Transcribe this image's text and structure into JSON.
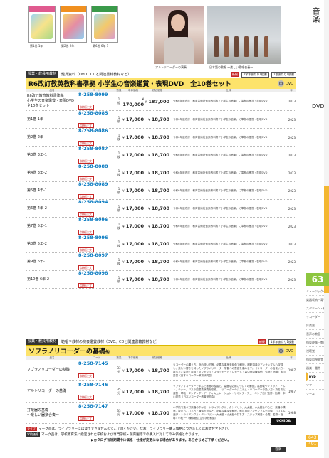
{
  "side": {
    "title": "音楽",
    "dvd": "DVD",
    "page_tab": "63",
    "page_num_1": "643",
    "page_num_2": "491",
    "menu": [
      "ミュージックベル",
      "楽器収納・電子楽器",
      "スクリーン・補助教材",
      "リコーダー",
      "打楽器",
      "音声の教室",
      "指導映像・教材",
      "視聴覚",
      "指導用視聴覚",
      "器楽・鑑賞",
      "DVD",
      "ソフト",
      "ツール"
    ]
  },
  "images": {
    "captions": [
      "第1巻 1年",
      "第2巻 2年",
      "第6巻 6年-1",
      "アルトリコーダーの演奏",
      "日本語の歌唱 ～楽しい歌唱合奏～"
    ]
  },
  "section1": {
    "cat_tag": "授業・教員用教材",
    "cat_text": "鑑賞資料（DVD、CDと関連書籍教材など）",
    "flag": "新規",
    "qty_note": "1学年あたり1枚書",
    "box_note": "1枚あたり1枚書",
    "title": "R6改訂教英教科書準拠 小学生の音楽鑑賞・表現DVD　全10巻セット",
    "dvd_label": "DVD",
    "headers": [
      "品名",
      "コード",
      "数量",
      "本体価格",
      "税込価格",
      "仕様",
      "年"
    ],
    "rows": [
      {
        "name": "R6改訂教育教科書準拠\n小学生の音楽鑑賞・表現DVD\n全10巻セット",
        "code": "8-258-8099",
        "btn": "詳細注文",
        "qty": "1\n組",
        "p1": "170,000",
        "p2": "187,000",
        "desc": "令和6年度改訂　教育芸術社音楽教科書「小学生の音楽」に準拠の鑑賞・表現DVD",
        "year": "2023"
      },
      {
        "name": "第1巻 1年",
        "code": "8-258-8085",
        "btn": "詳細注文",
        "qty": "1\n枚",
        "p1": "17,000",
        "p2": "18,700",
        "desc": "令和6年度改訂　教育芸術社音楽教科書「小学生の音楽」に準拠の鑑賞・表現DVD",
        "year": "2023"
      },
      {
        "name": "第2巻 2年",
        "code": "8-258-8086",
        "btn": "詳細注文",
        "qty": "1\n枚",
        "p1": "17,000",
        "p2": "18,700",
        "desc": "令和6年度改訂　教育芸術社音楽教科書「小学生の音楽」に準拠の鑑賞・表現DVD",
        "year": "2023"
      },
      {
        "name": "第3巻 3年-1",
        "code": "8-258-8087",
        "btn": "詳細注文",
        "qty": "1\n枚",
        "p1": "17,000",
        "p2": "18,700",
        "desc": "令和6年度改訂　教育芸術社音楽教科書「小学生の音楽」に準拠の鑑賞・表現DVD",
        "year": "2023"
      },
      {
        "name": "第4巻 3年-2",
        "code": "8-258-8088",
        "btn": "詳細注文",
        "qty": "1\n枚",
        "p1": "17,000",
        "p2": "18,700",
        "desc": "令和6年度改訂　教育芸術社音楽教科書「小学生の音楽」に準拠の鑑賞・表現DVD",
        "year": "2023"
      },
      {
        "name": "第5巻 4年-1",
        "code": "8-258-8089",
        "btn": "詳細注文",
        "qty": "1\n枚",
        "p1": "17,000",
        "p2": "18,700",
        "desc": "令和6年度改訂　教育芸術社音楽教科書「小学生の音楽」に準拠の鑑賞・表現DVD",
        "year": "2023"
      },
      {
        "name": "第6巻 4年-2",
        "code": "8-258-8094",
        "btn": "詳細注文",
        "qty": "1\n枚",
        "p1": "17,000",
        "p2": "18,700",
        "desc": "令和6年度改訂　教育芸術社音楽教科書「小学生の音楽」に準拠の鑑賞・表現DVD",
        "year": "2023"
      },
      {
        "name": "第7巻 5年-1",
        "code": "8-258-8095",
        "btn": "詳細注文",
        "qty": "1\n枚",
        "p1": "17,000",
        "p2": "18,700",
        "desc": "令和6年度改訂　教育芸術社音楽教科書「小学生の音楽」に準拠の鑑賞・表現DVD",
        "year": "2023"
      },
      {
        "name": "第8巻 5年-2",
        "code": "8-258-8096",
        "btn": "詳細注文",
        "qty": "1\n枚",
        "p1": "17,000",
        "p2": "18,700",
        "desc": "令和6年度改訂　教育芸術社音楽教科書「小学生の音楽」に準拠の鑑賞・表現DVD",
        "year": "2023"
      },
      {
        "name": "第9巻 6年-1",
        "code": "8-258-8097",
        "btn": "詳細注文",
        "qty": "1\n枚",
        "p1": "17,000",
        "p2": "18,700",
        "desc": "令和6年度改訂　教育芸術社音楽教科書「小学生の音楽」に準拠の鑑賞・表現DVD",
        "year": "2023"
      },
      {
        "name": "第10巻 6年-2",
        "code": "8-258-8098",
        "btn": "詳細注文",
        "qty": "1\n枚",
        "p1": "17,000",
        "p2": "18,700",
        "desc": "令和6年度改訂　教育芸術社音楽教科書「小学生の音楽」に準拠の鑑賞・表現DVD",
        "year": "2023"
      }
    ]
  },
  "section2": {
    "cat_tag": "授業・教員用教材",
    "cat_text": "範唱や教材の演奏鑑賞教材（DVD、CDと関連書籍教材など）",
    "flag": "新規",
    "qty_note": "1学年あたり1枚書",
    "title": "ソプラノリコーダーの基礎",
    "title_suffix": "他",
    "dvd_label": "DVD",
    "headers": [
      "品名",
      "コード",
      "数量",
      "本体価格",
      "税込価格",
      "仕様",
      "年"
    ],
    "rows": [
      {
        "name": "ソプラノリコーダーの基礎",
        "code": "8-258-7145",
        "btn": "詳細注文",
        "qty": "33\n分",
        "p1": "17,000",
        "p2": "18,700",
        "desc": "リコーダーの構え方、指の使い方等、必要な事柄を映像で解説。模範演奏やアンサンブルも収録し、美しい響きを持ったソプラノリコーダー学習への意欲を高めます。（リコーダーの指使い方・持ち方と姿勢・呼吸・タンギング・スタッカート・レガート・高い音の練習他）監修・指導：本山秀男（日本リコーダー教育研究会）",
        "year": "1987"
      },
      {
        "name": "アルトリコーダーの基礎",
        "code": "8-258-7146",
        "btn": "詳細注文",
        "qty": "35\n分",
        "p1": "17,000",
        "p2": "18,700",
        "desc": "ソプラノリコーダーで学んだ基礎の復習と、高度な応用についての解説。高音域やソプラノ、アルト、テナー、バスの四重奏演奏を収録。（リコーダーのシステム・リコーダーの扱い方・持ち方と姿勢・呼吸・タンギング・アーティキュレーション・サミング・チューニング他）監修・指導：本山秀男（日本リコーダー教育研究会）",
        "year": "1987"
      },
      {
        "name": "打楽器の基礎\n～楽しい器楽合奏～",
        "code": "8-258-7147",
        "btn": "詳細注文",
        "qty": "33\n分",
        "p1": "17,000",
        "p2": "18,700",
        "desc": "小学校で扱う打楽器の中から、トライアングル、タンバリン、大太鼓、小太鼓を中心に、楽器の構造、扱い方、打ち方と練習方法など、必要な事項を解説。鑑賞用のアンサンブルを収録。（リズム遊び・トライアングル・タンバリン・大太鼓・小太鼓の打ち方・ステップ演奏・合奏）監修・指導：小松 一（東京都公立小学校教諭）",
        "year": "1988"
      }
    ]
  },
  "brand": "UCHIDA",
  "notes": {
    "line1_mark": "ライブ",
    "line1": "マーク品は、ライブラリーには貸出できませんのでご了承ください。なお、ライブラリー購入価格につきましてはお問合せ下さい。",
    "line2_mark": "学校価格",
    "line2": "マーク品は、学校教育法に指定された学校および専門学校・保育園等での購入に対してのみ価格となります。",
    "line3": "▶カタログ有効期間中に価格・仕様が変更になる場合があります。あらかじめご了承ください。"
  },
  "footer": {
    "label": "音楽",
    "badge": "音楽"
  }
}
